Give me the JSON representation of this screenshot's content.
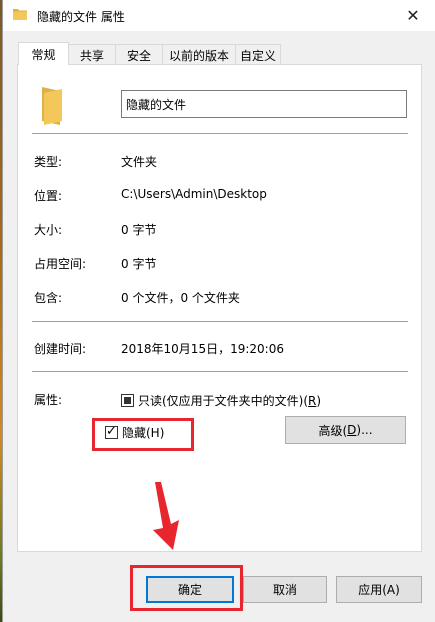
{
  "window": {
    "title": "隐藏的文件 属性",
    "close_glyph": "✕"
  },
  "tabs": [
    {
      "label": "常规",
      "active": true
    },
    {
      "label": "共享",
      "active": false
    },
    {
      "label": "安全",
      "active": false
    },
    {
      "label": "以前的版本",
      "active": false
    },
    {
      "label": "自定义",
      "active": false
    }
  ],
  "general": {
    "folder_name": "隐藏的文件",
    "rows": {
      "type": {
        "label": "类型:",
        "value": "文件夹"
      },
      "location": {
        "label": "位置:",
        "value": "C:\\Users\\Admin\\Desktop"
      },
      "size": {
        "label": "大小:",
        "value": "0 字节"
      },
      "size_on_disk": {
        "label": "占用空间:",
        "value": "0 字节"
      },
      "contains": {
        "label": "包含:",
        "value": "0 个文件，0 个文件夹"
      },
      "created": {
        "label": "创建时间:",
        "value": "2018年10月15日，19:20:06"
      }
    },
    "attributes": {
      "label": "属性:",
      "readonly_text": "只读(仅应用于文件夹中的文件)(",
      "readonly_key": "R",
      "readonly_close": ")",
      "readonly_state": "indeterminate",
      "hidden_text": "隐藏(H)",
      "hidden_checked": true,
      "advanced_text": "高级(",
      "advanced_key": "D",
      "advanced_close": ")..."
    }
  },
  "buttons": {
    "ok": "确定",
    "cancel": "取消",
    "apply": "应用(A)"
  },
  "icons": {
    "title": "folder-icon",
    "big": "folder-icon",
    "close": "close-icon",
    "annotation": "red-arrow-icon"
  },
  "colors": {
    "accent": "#0078d7",
    "annotation": "#e8262e",
    "folder": "#f4c75a"
  }
}
